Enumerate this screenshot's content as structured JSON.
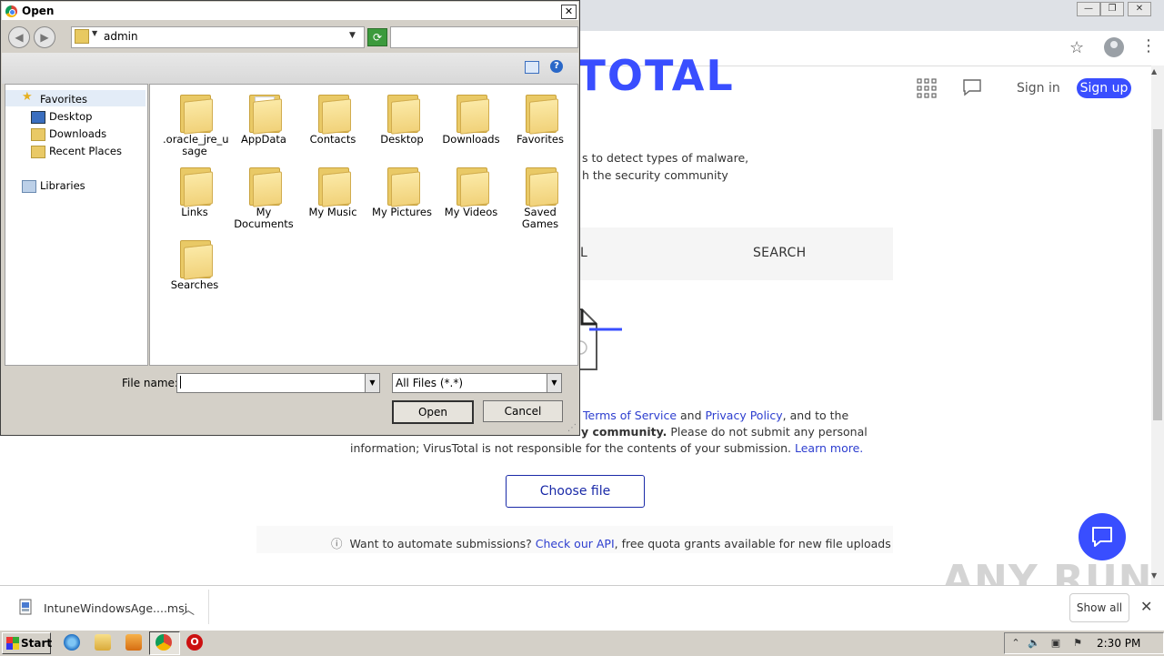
{
  "browser": {
    "window_controls": {
      "minimize": "—",
      "restore": "❐",
      "close": "✕"
    },
    "toolbar_icons": [
      "star-icon",
      "profile-icon",
      "menu-icon"
    ]
  },
  "virustotal": {
    "logo_partial": "USTOTAL",
    "header": {
      "sign_in": "Sign in",
      "sign_up": "Sign up"
    },
    "tagline_line1": "s to detect types of malware,",
    "tagline_line2": "h the security community",
    "tab_search": "SEARCH",
    "tab_partial": "L",
    "terms": {
      "line1_pre": "",
      "terms_link": "Terms of Service",
      "and": " and ",
      "privacy_link": "Privacy Policy",
      "line1_post": ", and to the",
      "line2_bold": "y community.",
      "line2_rest": " Please do not submit any personal",
      "line3": "information; VirusTotal is not responsible for the contents of your submission. ",
      "learn_more": "Learn more."
    },
    "choose_file": "Choose file",
    "api": {
      "pre": "Want to automate submissions? ",
      "link": "Check our API",
      "post": ", free quota grants available for new file uploads"
    },
    "watermark": "ANY RUN",
    "accent_color": "#394eff"
  },
  "download_shelf": {
    "item_name": "IntuneWindowsAge....msi",
    "show_all": "Show all",
    "close": "✕"
  },
  "taskbar": {
    "start": "Start",
    "clock": "2:30 PM",
    "pinned": [
      "ie-icon",
      "explorer-icon",
      "media-player-icon",
      "chrome-icon",
      "opera-icon"
    ]
  },
  "dialog": {
    "title": "Open",
    "address": "admin",
    "nav_pane": {
      "favorites": "Favorites",
      "items": [
        "Desktop",
        "Downloads",
        "Recent Places"
      ],
      "libraries": "Libraries"
    },
    "folders": [
      {
        "line1": ".oracle_jre_u",
        "line2": "sage"
      },
      {
        "line1": "AppData",
        "line2": ""
      },
      {
        "line1": "Contacts",
        "line2": ""
      },
      {
        "line1": "Desktop",
        "line2": ""
      },
      {
        "line1": "Downloads",
        "line2": ""
      },
      {
        "line1": "Favorites",
        "line2": ""
      },
      {
        "line1": "Links",
        "line2": ""
      },
      {
        "line1": "My",
        "line2": "Documents"
      },
      {
        "line1": "My Music",
        "line2": ""
      },
      {
        "line1": "My Pictures",
        "line2": ""
      },
      {
        "line1": "My Videos",
        "line2": ""
      },
      {
        "line1": "Saved",
        "line2": "Games"
      },
      {
        "line1": "Searches",
        "line2": ""
      }
    ],
    "file_name_label": "File name:",
    "file_name_value": "",
    "file_type": "All Files (*.*)",
    "open_button": "Open",
    "cancel_button": "Cancel"
  }
}
